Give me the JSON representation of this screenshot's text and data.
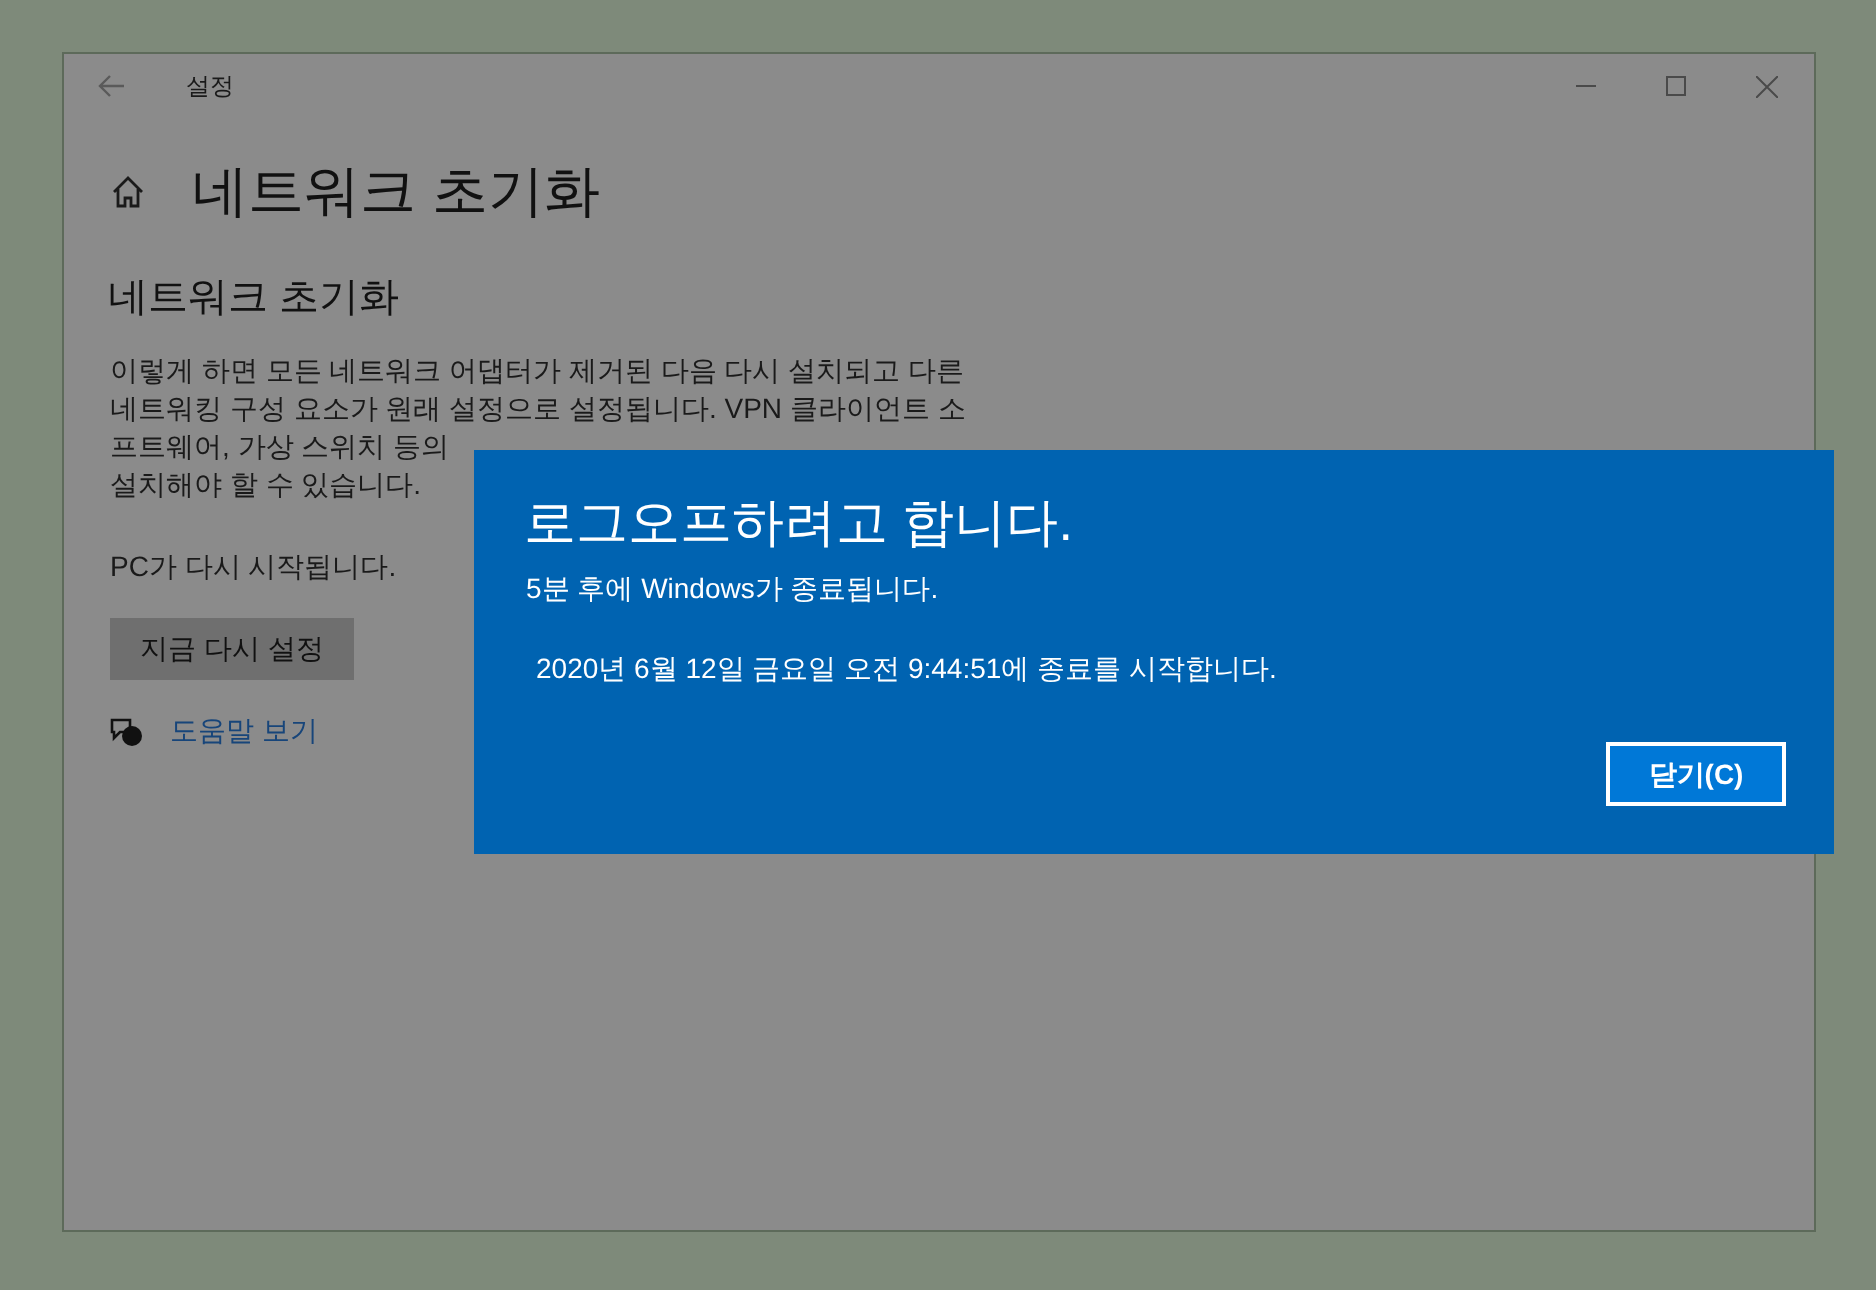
{
  "window": {
    "title": "설정"
  },
  "page": {
    "title": "네트워크 초기화",
    "section_title": "네트워크 초기화",
    "description_lines": [
      "이렇게 하면 모든 네트워크 어댑터가 제거된 다음 다시 설치되고 다른",
      "네트워킹 구성 요소가 원래 설정으로 설정됩니다. VPN 클라이언트 소",
      "프트웨어, 가상 스위치 등의",
      "설치해야 할 수 있습니다."
    ],
    "restart_note": "PC가 다시 시작됩니다.",
    "reset_button": "지금 다시 설정",
    "help_link": "도움말 보기"
  },
  "dialog": {
    "title": "로그오프하려고 합니다.",
    "message": "5분 후에 Windows가 종료됩니다.",
    "detail": "2020년 6월 12일 금요일 오전 9:44:51에 종료를 시작합니다.",
    "close_button": "닫기(C)"
  }
}
